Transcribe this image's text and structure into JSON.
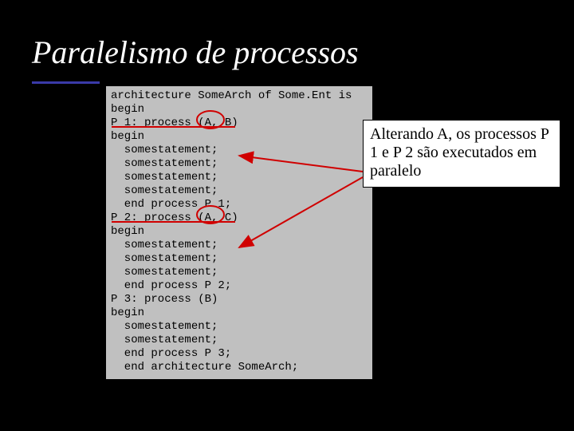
{
  "title": "Paralelismo de processos",
  "code": {
    "l1": "architecture SomeArch of Some.Ent is",
    "l2": "begin",
    "l3": "P 1: process (A, B)",
    "l4": "begin",
    "l5": "  somestatement;",
    "l6": "  somestatement;",
    "l7": "  somestatement;",
    "l8": "  somestatement;",
    "l9": "  end process P 1;",
    "l10": "P 2: process (A, C)",
    "l11": "begin",
    "l12": "  somestatement;",
    "l13": "  somestatement;",
    "l14": "  somestatement;",
    "l15": "  end process P 2;",
    "l16": "P 3: process (B)",
    "l17": "begin",
    "l18": "  somestatement;",
    "l19": "  somestatement;",
    "l20": "  end process P 3;",
    "l21": "  end architecture SomeArch;"
  },
  "callout": "Alterando A, os processos P 1 e P 2 são executados em paralelo"
}
